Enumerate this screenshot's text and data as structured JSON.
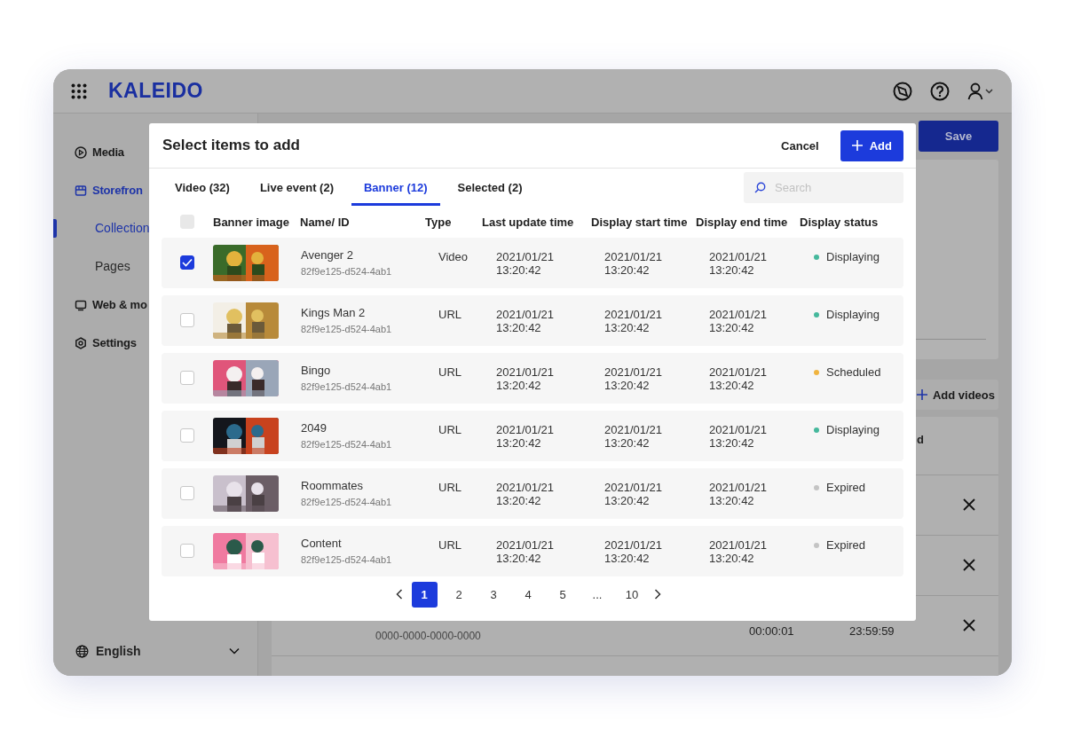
{
  "app": {
    "logo": "KALEIDO",
    "sidebar": [
      {
        "label": "Media",
        "selected": false
      },
      {
        "label": "Storefron",
        "selected": true,
        "children": [
          {
            "label": "Collection",
            "selected": true
          },
          {
            "label": "Pages",
            "selected": false
          }
        ]
      },
      {
        "label": "Web & mo",
        "selected": false
      },
      {
        "label": "Settings",
        "selected": false
      }
    ],
    "language": "English",
    "save_button": "Save",
    "add_videos_button": "Add videos",
    "table": {
      "header_fragment": "d",
      "row_texts": [
        "0000-0000-0000-0000",
        "00:00:01",
        "23:59:59"
      ]
    }
  },
  "modal": {
    "title": "Select items to add",
    "cancel_button": "Cancel",
    "add_button": "Add",
    "tabs": [
      {
        "label": "Video (32)",
        "selected": false
      },
      {
        "label": "Live event (2)",
        "selected": false
      },
      {
        "label": "Banner (12)",
        "selected": true
      },
      {
        "label": "Selected (2)",
        "selected": false
      }
    ],
    "search": {
      "placeholder": "Search"
    },
    "select_all": {
      "checked": false
    },
    "columns": [
      "Banner image",
      "Name/ ID",
      "Type",
      "Last update time",
      "Display start time",
      "Display end time",
      "Display status"
    ],
    "rows": [
      {
        "checked": true,
        "name": "Avenger 2",
        "id": "82f9e125-d524-4ab1",
        "type": "Video",
        "last_update": "2021/01/21 13:20:42",
        "start": "2021/01/21 13:20:42",
        "end": "2021/01/21 13:20:42",
        "status": "Displaying",
        "color": "#45b89c"
      },
      {
        "checked": false,
        "name": "Kings Man 2",
        "id": "82f9e125-d524-4ab1",
        "type": "URL",
        "last_update": "2021/01/21 13:20:42",
        "start": "2021/01/21 13:20:42",
        "end": "2021/01/21 13:20:42",
        "status": "Displaying",
        "color": "#45b89c"
      },
      {
        "checked": false,
        "name": "Bingo",
        "id": "82f9e125-d524-4ab1",
        "type": "URL",
        "last_update": "2021/01/21 13:20:42",
        "start": "2021/01/21 13:20:42",
        "end": "2021/01/21 13:20:42",
        "status": "Scheduled",
        "color": "#f0b440"
      },
      {
        "checked": false,
        "name": "2049",
        "id": "82f9e125-d524-4ab1",
        "type": "URL",
        "last_update": "2021/01/21 13:20:42",
        "start": "2021/01/21 13:20:42",
        "end": "2021/01/21 13:20:42",
        "status": "Displaying",
        "color": "#45b89c"
      },
      {
        "checked": false,
        "name": "Roommates",
        "id": "82f9e125-d524-4ab1",
        "type": "URL",
        "last_update": "2021/01/21 13:20:42",
        "start": "2021/01/21 13:20:42",
        "end": "2021/01/21 13:20:42",
        "status": "Expired",
        "color": "#c4c4c4"
      },
      {
        "checked": false,
        "name": "Content",
        "id": "82f9e125-d524-4ab1",
        "type": "URL",
        "last_update": "2021/01/21 13:20:42",
        "start": "2021/01/21 13:20:42",
        "end": "2021/01/21 13:20:42",
        "status": "Expired",
        "color": "#c4c4c4"
      }
    ],
    "pagination": [
      {
        "label": "1",
        "selected": true
      },
      {
        "label": "2",
        "selected": false
      },
      {
        "label": "3",
        "selected": false
      },
      {
        "label": "4",
        "selected": false
      },
      {
        "label": "5",
        "selected": false
      },
      {
        "label": "...",
        "selected": false
      },
      {
        "label": "10",
        "selected": false
      }
    ]
  }
}
